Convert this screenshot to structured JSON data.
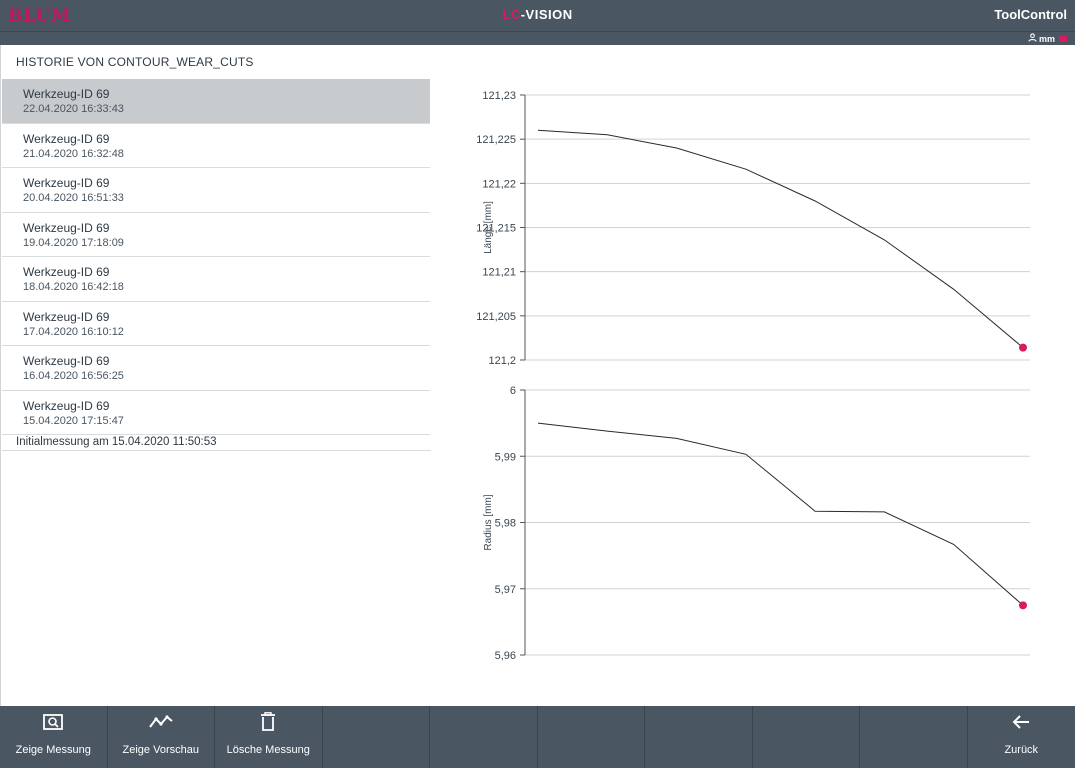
{
  "header": {
    "brand": "BLUM",
    "title_accent": "LC",
    "title_rest": "-VISION",
    "module": "ToolControl",
    "unit": "mm"
  },
  "history": {
    "title": "HISTORIE VON CONTOUR_WEAR_CUTS",
    "items": [
      {
        "title": "Werkzeug-ID 69",
        "date": "22.04.2020 16:33:43",
        "selected": true
      },
      {
        "title": "Werkzeug-ID 69",
        "date": "21.04.2020 16:32:48"
      },
      {
        "title": "Werkzeug-ID 69",
        "date": "20.04.2020 16:51:33"
      },
      {
        "title": "Werkzeug-ID 69",
        "date": "19.04.2020 17:18:09"
      },
      {
        "title": "Werkzeug-ID 69",
        "date": "18.04.2020 16:42:18"
      },
      {
        "title": "Werkzeug-ID 69",
        "date": "17.04.2020 16:10:12"
      },
      {
        "title": "Werkzeug-ID 69",
        "date": "16.04.2020 16:56:25"
      },
      {
        "title": "Werkzeug-ID 69",
        "date": "15.04.2020 17:15:47"
      }
    ],
    "initial": "Initialmessung am 15.04.2020 11:50:53"
  },
  "chart_data": [
    {
      "type": "line",
      "ylabel": "Länge [mm]",
      "ylim": [
        121.2,
        121.23
      ],
      "yticks": [
        121.23,
        121.225,
        121.22,
        121.215,
        121.21,
        121.205,
        121.2
      ],
      "ytick_labels": [
        "121,23",
        "121,225",
        "121,22",
        "121,215",
        "121,21",
        "121,205",
        "121,2"
      ],
      "values": [
        121.226,
        121.2255,
        121.224,
        121.2216,
        121.218,
        121.2136,
        121.208,
        121.2014
      ],
      "grid": true,
      "highlight_last": true
    },
    {
      "type": "line",
      "ylabel": "Radius [mm]",
      "ylim": [
        5.96,
        6.0
      ],
      "yticks": [
        6.0,
        5.99,
        5.98,
        5.97,
        5.96
      ],
      "ytick_labels": [
        "6",
        "5,99",
        "5,98",
        "5,97",
        "5,96"
      ],
      "values": [
        5.995,
        5.9938,
        5.9927,
        5.9903,
        5.9817,
        5.9816,
        5.9767,
        5.9675
      ],
      "grid": true,
      "highlight_last": true
    }
  ],
  "colors": {
    "bar": "#4a5661",
    "accent": "#d81b60",
    "line": "#2a2a2a",
    "grid": "#cfd3d6"
  },
  "toolbar": {
    "show_measurement": "Zeige Messung",
    "show_preview": "Zeige Vorschau",
    "delete_measurement": "Lösche Messung",
    "back": "Zurück"
  }
}
